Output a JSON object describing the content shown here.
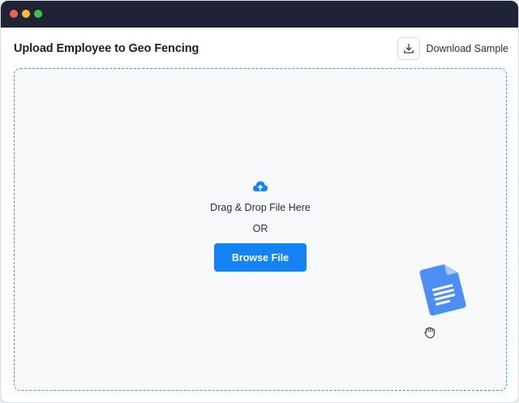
{
  "window": {
    "controls": [
      "close",
      "minimize",
      "maximize"
    ]
  },
  "header": {
    "title": "Upload Employee to Geo Fencing",
    "download_label": "Download Sample",
    "download_icon": "download-icon"
  },
  "dropzone": {
    "upload_icon": "cloud-upload-icon",
    "drag_text": "Drag & Drop File Here",
    "or_text": "OR",
    "browse_label": "Browse File",
    "file_icon": "document-icon",
    "cursor_icon": "grab-hand-icon"
  },
  "colors": {
    "titlebar": "#1f2336",
    "accent": "#1483f5",
    "dropzone_border": "#4a9a97",
    "dropzone_bg": "#f7f9fb"
  }
}
